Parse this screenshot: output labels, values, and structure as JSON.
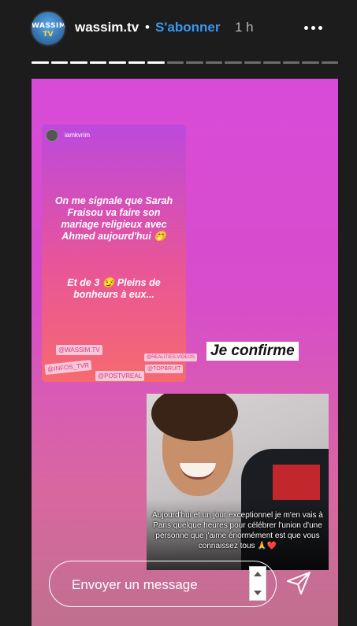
{
  "header": {
    "avatar_logo_top": "WASSIM",
    "avatar_logo_bottom": "TV",
    "username": "wassim.tv",
    "separator": "•",
    "follow_label": "S'abonner",
    "time": "1 h",
    "more_icon": "more-horizontal-icon"
  },
  "progress": {
    "segments": 16,
    "completed": 7
  },
  "story": {
    "inner_post": {
      "username": "iamkvrim",
      "message_1": "On me signale que Sarah Fraisou va faire son mariage religieux avec Ahmed aujourd'hui 🤭",
      "message_2": "Et de 3 😏 Pleins de bonheurs à eux...",
      "tags": [
        "@WASSIM.TV",
        "@INFOS_TVR",
        "@POSTVREAL",
        "@REALITIES.VIDEOS",
        "@TOPBRUIT"
      ]
    },
    "confirm_text": "Je confirme",
    "photo_caption": "Aujourd'hui et un jour exceptionnel je m'en vais à Paris quelque heures pour célébrer l'union d'une personne que j'aime énormément est que vous connaissez tous 🙏❤️"
  },
  "reply": {
    "placeholder": "Envoyer un message",
    "send_icon": "paper-plane-icon"
  }
}
